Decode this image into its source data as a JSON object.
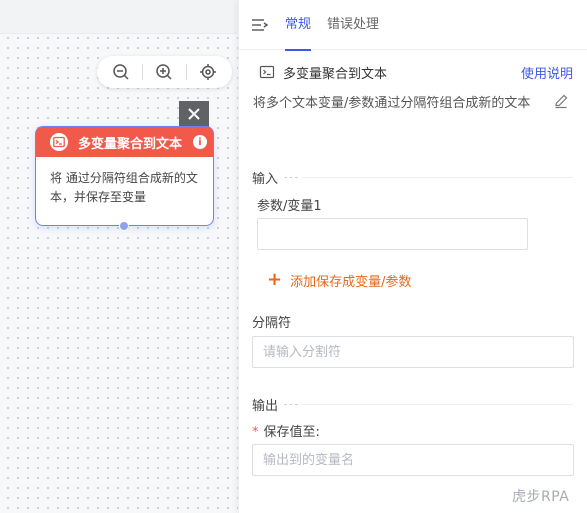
{
  "canvas": {
    "node": {
      "title": "多变量聚合到文本",
      "description": "将 通过分隔符组合成新的文本，并保存至变量",
      "header_color": "#f15a4a",
      "border_color": "#6f82f5"
    },
    "zoom_tools": [
      "zoom-out-icon",
      "zoom-in-icon",
      "locate-icon"
    ]
  },
  "panel": {
    "tabs": [
      {
        "label": "常规",
        "active": true
      },
      {
        "label": "错误处理",
        "active": false
      }
    ],
    "tool": {
      "name": "多变量聚合到文本",
      "help_label": "使用说明",
      "description": "将多个文本变量/参数通过分隔符组合成新的文本"
    },
    "input_section": {
      "title": "输入",
      "param_label": "参数/变量1",
      "param_value": "",
      "add_label": "添加保存成变量/参数"
    },
    "separator": {
      "label": "分隔符",
      "placeholder": "请输入分割符",
      "value": ""
    },
    "output_section": {
      "title": "输出",
      "save_label": "保存值至:",
      "required_mark": "*",
      "placeholder": "输出到的变量名",
      "value": ""
    },
    "watermark": "虎步RPA"
  },
  "colors": {
    "accent": "#3d58e6",
    "add_link": "#e8671b",
    "required": "#f15a4a"
  }
}
